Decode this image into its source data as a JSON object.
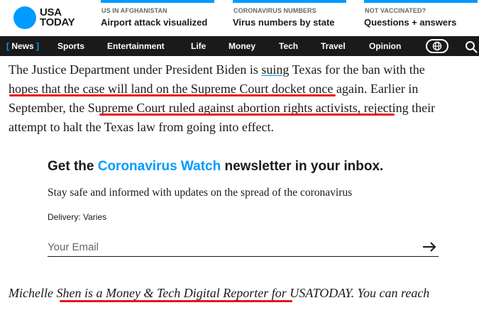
{
  "header": {
    "logo_text_line1": "USA",
    "logo_text_line2": "TODAY",
    "promos": [
      {
        "label": "US IN AFGHANISTAN",
        "title": "Airport attack visualized"
      },
      {
        "label": "CORONAVIRUS NUMBERS",
        "title": "Virus numbers by state"
      },
      {
        "label": "NOT VACCINATED?",
        "title": "Questions + answers"
      }
    ]
  },
  "nav": {
    "items": [
      "News",
      "Sports",
      "Entertainment",
      "Life",
      "Money",
      "Tech",
      "Travel",
      "Opinion"
    ],
    "active_bracket_open": "[",
    "active_bracket_close": "]"
  },
  "article": {
    "p1_a": "The Justice Department under President Biden is ",
    "p1_link1": "suing",
    "p1_b": " Texas for the ban with the ",
    "p1_hl1": "hopes that the case will land on the Supreme Court docket",
    "p1_c": " once again. Earlier in September, the ",
    "p1_hl2a": "Supreme Court ",
    "p1_link2": "ruled",
    "p1_hl2b": " against abortion rights activists",
    "p1_d": ", rejecting their attempt to halt the Texas law from going into effect."
  },
  "newsletter": {
    "title_a": "Get the ",
    "title_accent": "Coronavirus Watch",
    "title_b": " newsletter in your inbox.",
    "subtitle": "Stay safe and informed with updates on the spread of the coronavirus",
    "delivery": "Delivery: Varies",
    "email_placeholder": "Your Email"
  },
  "author": {
    "text_a": "Michelle ",
    "text_hl": "Shen is a Money & Tech Digital Reporter",
    "text_b": " for USATODAY. You can reach"
  },
  "colors": {
    "brand_blue": "#009bff",
    "annotation_red": "#e8141c",
    "nav_bg": "#1a1a1a"
  }
}
